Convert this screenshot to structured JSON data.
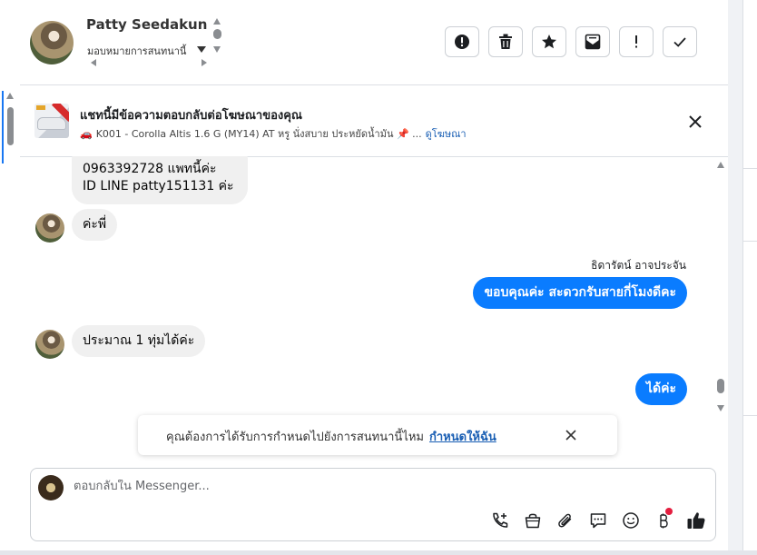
{
  "header": {
    "contact_name": "Patty Seedakun",
    "assign_label": "มอบหมายการสนทนานี้",
    "actions": [
      {
        "name": "report-spam",
        "icon": "alert-circle-icon"
      },
      {
        "name": "delete",
        "icon": "trash-icon"
      },
      {
        "name": "star",
        "icon": "star-icon"
      },
      {
        "name": "mark-unread",
        "icon": "envelope-icon"
      },
      {
        "name": "follow-up",
        "icon": "exclamation-icon"
      },
      {
        "name": "mark-done",
        "icon": "check-icon"
      }
    ]
  },
  "ad": {
    "title": "แชทนี้มีข้อความตอบกลับต่อโฆษณาของคุณ",
    "subtitle": "K001 - Corolla Altis 1.6 G (MY14) AT หรู นั่งสบาย ประหยัดน้ำมัน 📌 ...",
    "link": "ดูโฆษณา"
  },
  "messages": {
    "m1_line1": "0963392728 แพทนี้ค่ะ",
    "m1_line2": "ID LINE  patty151131 ค่ะ",
    "m2": "ค่ะพี่",
    "sender_name": "ธิดารัตน์ อาจประจัน",
    "m3": "ขอบคุณค่ะ สะดวกรับสายกี่โมงดีคะ",
    "m4": "ประมาณ 1 ทุ่มได้ค่ะ",
    "m5": "ได้ค่ะ"
  },
  "reminder": {
    "text": "คุณต้องการได้รับการกำหนดไปยังการสนทนานี้ไหม",
    "link": "กำหนดให้ฉัน"
  },
  "composer": {
    "placeholder": "ตอบกลับใน Messenger...",
    "tools": [
      "phone-plus-icon",
      "shopping-bag-icon",
      "paperclip-icon",
      "chat-bubble-icon",
      "emoji-icon",
      "baht-icon",
      "thumbs-up-icon"
    ]
  },
  "colors": {
    "outgoing_bubble": "#0a7cff",
    "incoming_bubble": "#f0f0f0",
    "link": "#1a5fb4"
  }
}
